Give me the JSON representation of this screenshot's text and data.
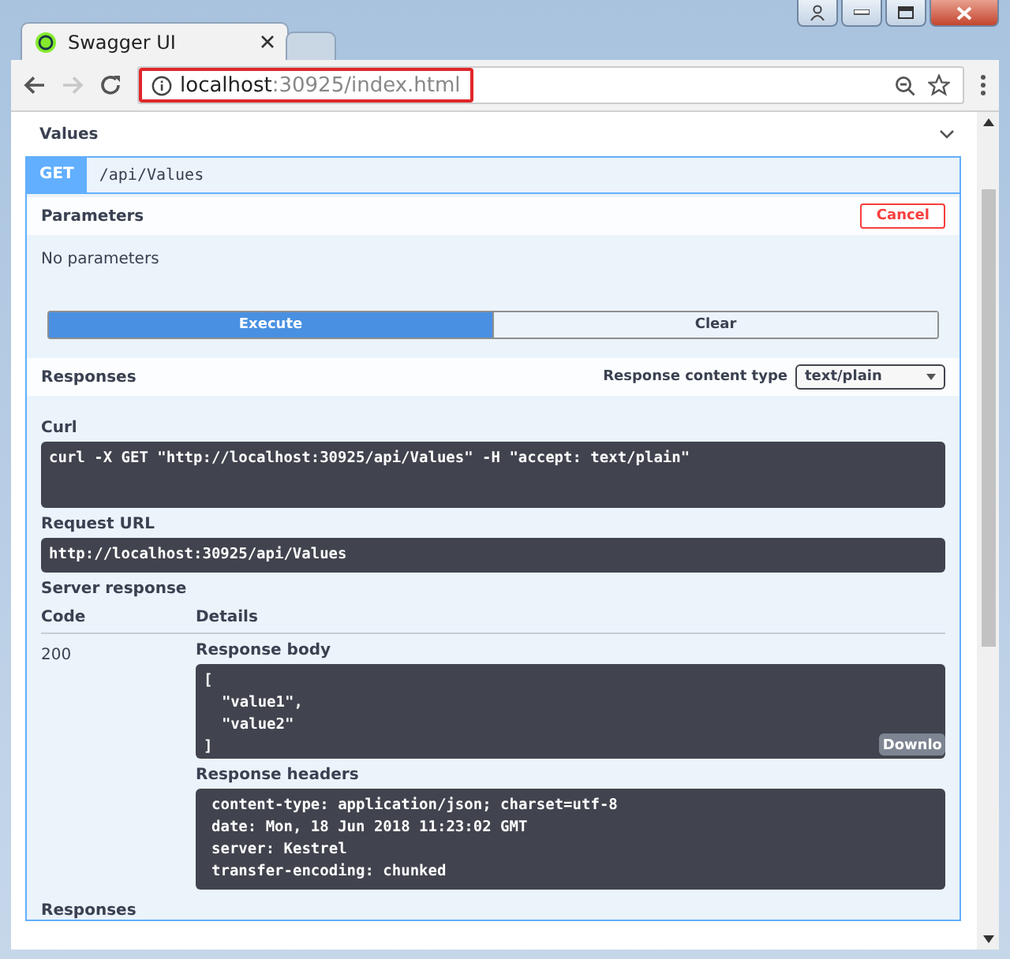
{
  "browser": {
    "tabs": [
      {
        "title": "Swagger UI",
        "selected": true
      },
      {
        "selected": false
      }
    ],
    "back_enabled": true,
    "forward_enabled": false,
    "address": {
      "host": "localhost",
      "rest": ":30925/index.html",
      "highlighted": true
    }
  },
  "section": {
    "title": "Values",
    "expanded": true
  },
  "operation": {
    "method": "GET",
    "path": "/api/Values"
  },
  "parameters": {
    "title": "Parameters",
    "cancel": "Cancel",
    "empty": "No parameters"
  },
  "actions": [
    {
      "label": "Execute",
      "selected": true
    },
    {
      "label": "Clear",
      "selected": false
    }
  ],
  "responses_bar": {
    "title": "Responses",
    "content_type_label": "Response content type",
    "content_type": "text/plain"
  },
  "curl": {
    "label": "Curl",
    "command": "curl -X GET \"http://localhost:30925/api/Values\" -H \"accept: text/plain\""
  },
  "request_url": {
    "label": "Request URL",
    "url": "http://localhost:30925/api/Values"
  },
  "server_response": {
    "title": "Server response",
    "columns": [
      "Code",
      "Details"
    ],
    "code": "200",
    "body_label": "Response body",
    "body": "[\n  \"value1\",\n  \"value2\"\n]",
    "download": "Downlo",
    "headers_label": "Response headers",
    "headers": "content-type: application/json; charset=utf-8\ndate: Mon, 18 Jun 2018 11:23:02 GMT\nserver: Kestrel\ntransfer-encoding: chunked"
  },
  "responses_title": "Responses"
}
